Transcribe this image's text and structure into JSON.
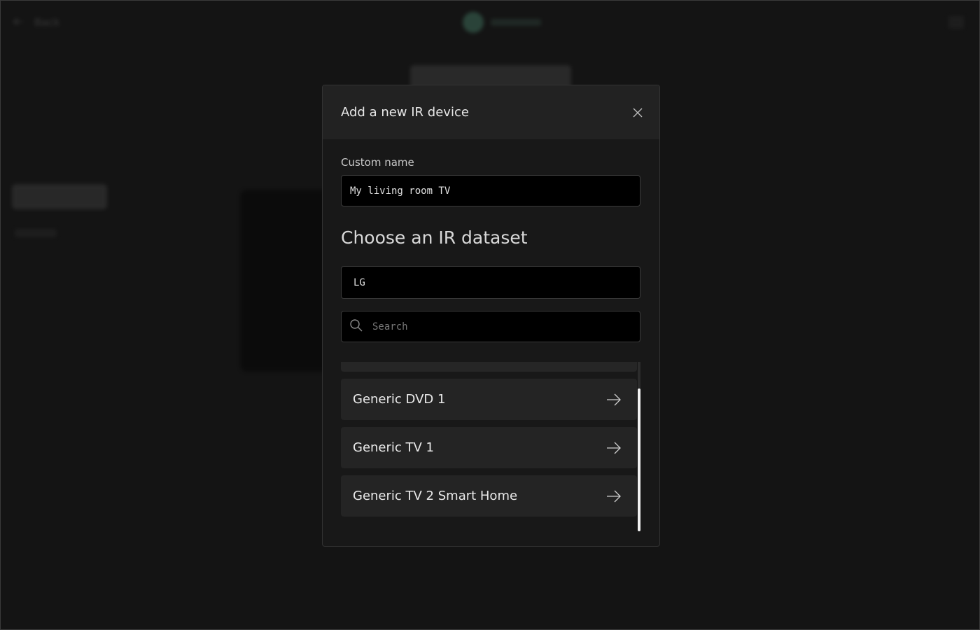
{
  "background": {
    "back_label": "Back"
  },
  "modal": {
    "title": "Add a new IR device",
    "custom_name": {
      "label": "Custom name",
      "value": "My living room TV"
    },
    "dataset_section_title": "Choose an IR dataset",
    "brand_select": {
      "value": "LG"
    },
    "search": {
      "placeholder": "Search",
      "value": ""
    },
    "datasets": [
      {
        "label": "Generic DVD 1"
      },
      {
        "label": "Generic TV 1"
      },
      {
        "label": "Generic TV 2 Smart Home"
      }
    ]
  },
  "colors": {
    "modal_bg": "#181818",
    "header_bg": "#222222",
    "item_bg": "#242424",
    "input_bg": "#000000",
    "scroll_thumb": "#f2f2f2"
  }
}
